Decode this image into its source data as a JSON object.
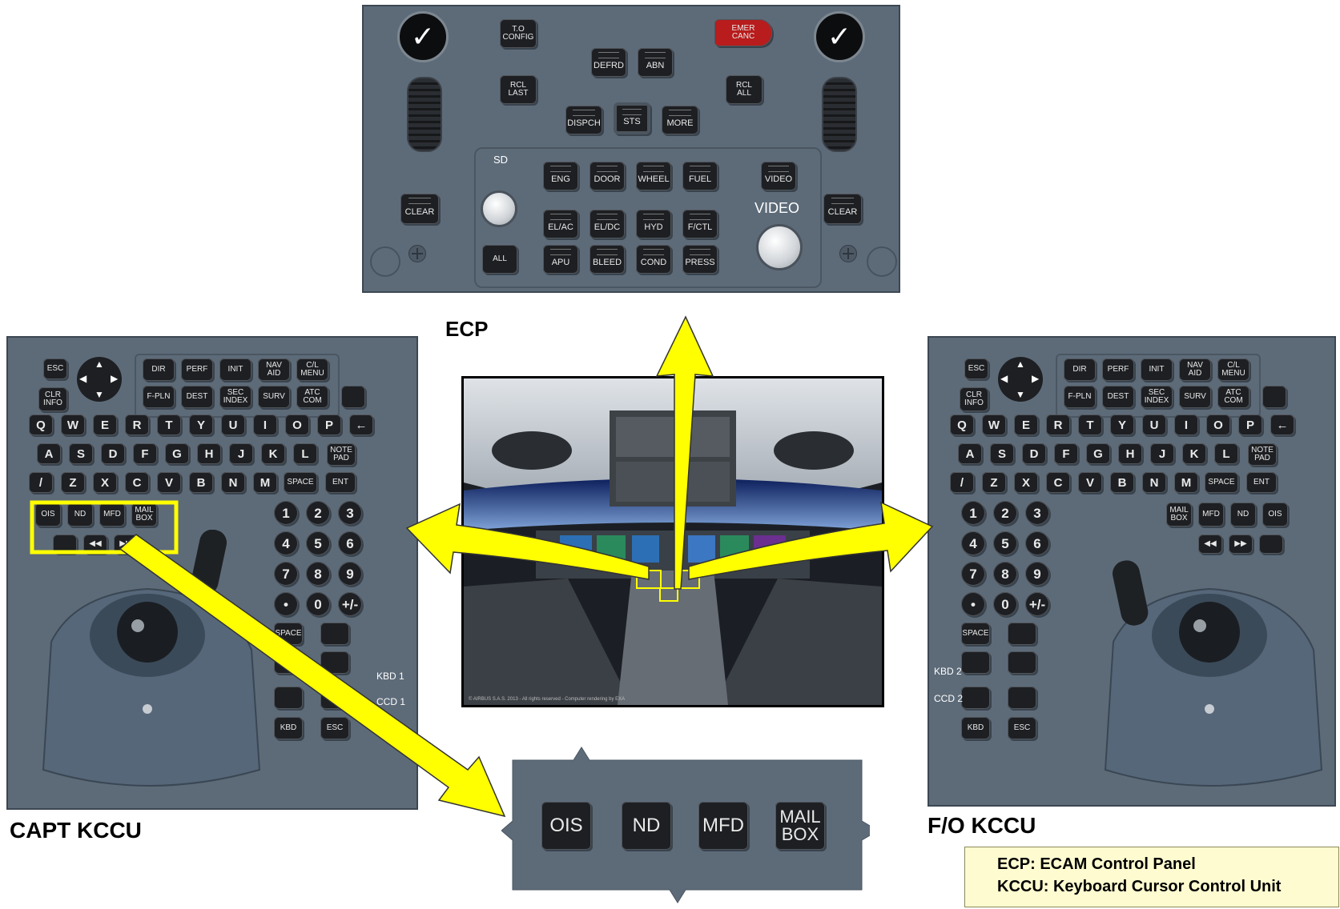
{
  "ecp": {
    "title": "ECP",
    "buttons": {
      "to_config": "T.O\nCONFIG",
      "emer_canc": "EMER\nCANC",
      "defrd": "DEFRD",
      "abn": "ABN",
      "rcl_last": "RCL\nLAST",
      "rcl_all": "RCL\nALL",
      "dispch": "DISPCH",
      "sts": "STS",
      "more": "MORE",
      "eng": "ENG",
      "door": "DOOR",
      "wheel": "WHEEL",
      "fuel": "FUEL",
      "video": "VIDEO",
      "elac": "EL/AC",
      "eldc": "EL/DC",
      "hyd": "HYD",
      "fctl": "F/CTL",
      "all": "ALL",
      "apu": "APU",
      "bleed": "BLEED",
      "cond": "COND",
      "press": "PRESS",
      "clear": "CLEAR"
    },
    "sd_label": "SD",
    "video_label": "VIDEO",
    "check_symbol": "✓"
  },
  "kccu": {
    "capt_title": "CAPT KCCU",
    "fo_title": "F/O KCCU",
    "fkeys": {
      "esc": "ESC",
      "clr_info": "CLR\nINFO",
      "dir": "DIR",
      "perf": "PERF",
      "init": "INIT",
      "nav_aid": "NAV\nAID",
      "cl_menu": "C/L\nMENU",
      "fpln": "F-PLN",
      "dest": "DEST",
      "sec_index": "SEC\nINDEX",
      "surv": "SURV",
      "atc_com": "ATC\nCOM"
    },
    "rows": [
      [
        "Q",
        "W",
        "E",
        "R",
        "T",
        "Y",
        "U",
        "I",
        "O",
        "P"
      ],
      [
        "A",
        "S",
        "D",
        "F",
        "G",
        "H",
        "J",
        "K",
        "L"
      ],
      [
        "/",
        "Z",
        "X",
        "C",
        "V",
        "B",
        "N",
        "M"
      ]
    ],
    "note_pad": "NOTE\nPAD",
    "space": "SPACE",
    "ent": "ENT",
    "backspace": "←",
    "display_keys": {
      "ois": "OIS",
      "nd": "ND",
      "mfd": "MFD",
      "mail_box": "MAIL\nBOX"
    },
    "rewind": "◀◀",
    "forward": "▶▶",
    "numpad": [
      "1",
      "2",
      "3",
      "4",
      "5",
      "6",
      "7",
      "8",
      "9",
      "•",
      "0",
      "+/-"
    ],
    "kbd": "KBD",
    "esc": "ESC",
    "capt_kbd_label": "KBD 1",
    "capt_ccd_label": "CCD 1",
    "fo_kbd_label": "KBD 2",
    "fo_ccd_label": "CCD 2"
  },
  "zoom": {
    "ois": "OIS",
    "nd": "ND",
    "mfd": "MFD",
    "mail_box": "MAIL\nBOX"
  },
  "cockpit": {
    "caption": "© AIRBUS S.A.S. 2013 - All rights reserved - Computer rendering by EXA"
  },
  "legend": {
    "line1": "ECP: ECAM Control Panel",
    "line2": "KCCU: Keyboard Cursor Control Unit"
  },
  "colors": {
    "panel": "#5d6b79",
    "key": "#1d1f22",
    "arrow": "#ffff00",
    "highlight": "#ffff00",
    "emer": "#cc2020"
  }
}
